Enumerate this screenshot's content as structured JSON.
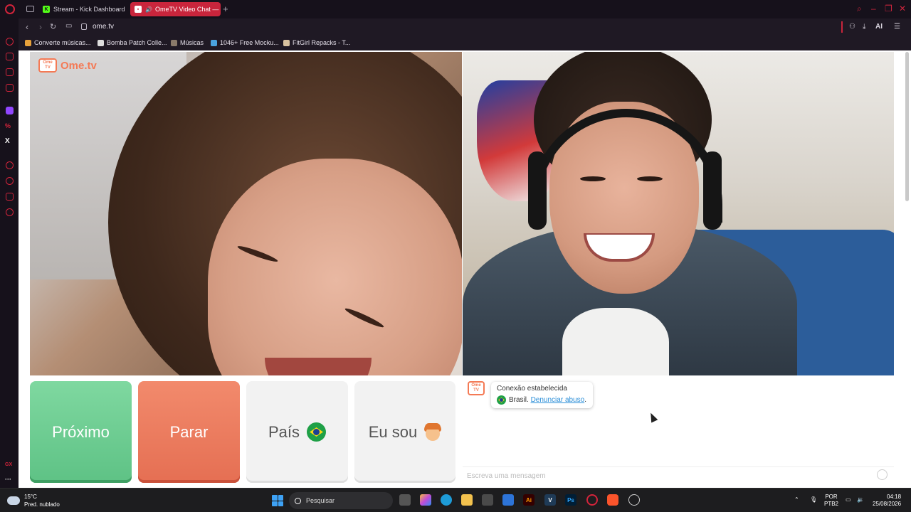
{
  "browser": {
    "tabs": [
      {
        "label": "Stream - Kick Dashboard",
        "active": false
      },
      {
        "label": "OmeTV Video Chat — C",
        "active": true
      }
    ],
    "address": "ome.tv",
    "ai_label": "AI",
    "bookmarks": [
      {
        "label": "Converte músicas...",
        "color": "#e9a23b"
      },
      {
        "label": "Bomba Patch Colle...",
        "color": "#dddddd"
      },
      {
        "label": "Músicas",
        "color": "#8a7a6a"
      },
      {
        "label": "1046+ Free Mocku...",
        "color": "#4aa3df"
      },
      {
        "label": "FitGirl Repacks - T...",
        "color": "#d8c2a0"
      }
    ],
    "sidebar_labels": {
      "x": "X",
      "gx": "GX"
    }
  },
  "ometv": {
    "logo_badge": "Ome TV",
    "logo_text": "Ome.tv",
    "buttons": {
      "next": "Próximo",
      "stop": "Parar",
      "country": "País",
      "gender": "Eu sou"
    },
    "chat": {
      "avatar_badge": "Ome TV",
      "status_line1": "Conexão estabelecida",
      "country": "Brasil.",
      "report_link": "Denunciar abuso",
      "report_suffix": ".",
      "input_placeholder": "Escreva uma mensagem"
    }
  },
  "taskbar": {
    "weather_temp": "15°C",
    "weather_desc": "Pred. nublado",
    "search_label": "Pesquisar",
    "lang_top": "POR",
    "lang_bottom": "PTB2",
    "time": "04:18",
    "date": "25/08/2026",
    "apps": [
      {
        "name": "illustrator",
        "label": "Ai",
        "color": "#330000",
        "text_color": "#ff9a00"
      },
      {
        "name": "vegas",
        "label": "V",
        "color": "#1f3b57",
        "text_color": "#ffffff"
      },
      {
        "name": "photoshop",
        "label": "Ps",
        "color": "#001e36",
        "text_color": "#31a8ff"
      }
    ]
  }
}
